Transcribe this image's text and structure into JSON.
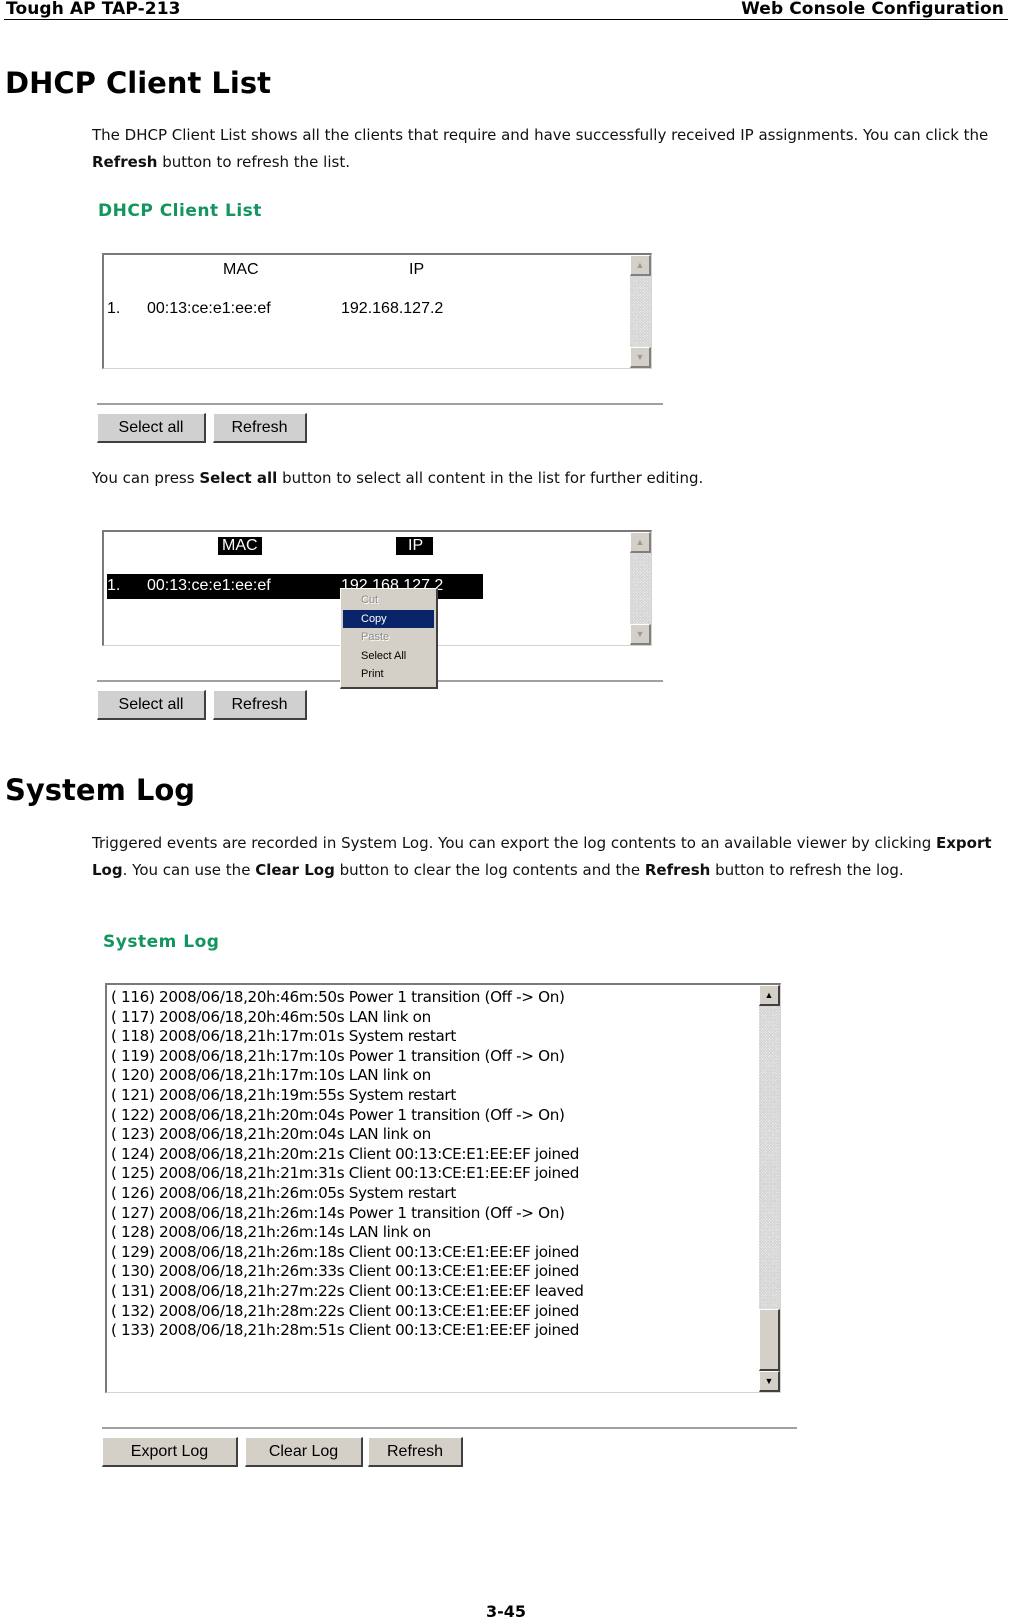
{
  "header": {
    "product": "Tough AP TAP-213",
    "section": "Web Console Configuration"
  },
  "dhcp": {
    "heading": "DHCP Client List",
    "intro": {
      "pre": "The DHCP Client List shows all the clients that require and have successfully received IP assignments. You can click the ",
      "bold": "Refresh",
      "post": " button to refresh the list."
    },
    "panel_title": "DHCP Client List",
    "columns": {
      "mac": "MAC",
      "ip": "IP"
    },
    "clients": [
      {
        "index": "1.",
        "mac": "00:13:ce:e1:ee:ef",
        "ip": "192.168.127.2"
      }
    ],
    "buttons": {
      "select_all": "Select all",
      "refresh": "Refresh"
    },
    "select_all_note": {
      "pre": "You can press ",
      "bold": "Select all",
      "post": " button to select all content in the list for further editing."
    },
    "context_menu": [
      {
        "label": "Cut",
        "state": "disabled"
      },
      {
        "label": "Copy",
        "state": "active"
      },
      {
        "label": "Paste",
        "state": "disabled"
      },
      {
        "label": "Select All",
        "state": "enabled"
      },
      {
        "label": "Print",
        "state": "enabled"
      }
    ]
  },
  "syslog": {
    "heading": "System Log",
    "intro": {
      "p1": "Triggered events are recorded in System Log. You can export the log contents to an available viewer by clicking ",
      "b1": "Export Log",
      "p2": ". You can use the ",
      "b2": "Clear Log",
      "p3": " button to clear the log contents and the ",
      "b3": "Refresh",
      "p4": " button to refresh the log."
    },
    "panel_title": "System Log",
    "entries": [
      "( 116) 2008/06/18,20h:46m:50s Power 1 transition (Off -> On)",
      "( 117) 2008/06/18,20h:46m:50s LAN link on",
      "( 118) 2008/06/18,21h:17m:01s System restart",
      "( 119) 2008/06/18,21h:17m:10s Power 1 transition (Off -> On)",
      "( 120) 2008/06/18,21h:17m:10s LAN link on",
      "( 121) 2008/06/18,21h:19m:55s System restart",
      "( 122) 2008/06/18,21h:20m:04s Power 1 transition (Off -> On)",
      "( 123) 2008/06/18,21h:20m:04s LAN link on",
      "( 124) 2008/06/18,21h:20m:21s Client 00:13:CE:E1:EE:EF joined",
      "( 125) 2008/06/18,21h:21m:31s Client 00:13:CE:E1:EE:EF joined",
      "( 126) 2008/06/18,21h:26m:05s System restart",
      "( 127) 2008/06/18,21h:26m:14s Power 1 transition (Off -> On)",
      "( 128) 2008/06/18,21h:26m:14s LAN link on",
      "( 129) 2008/06/18,21h:26m:18s Client 00:13:CE:E1:EE:EF joined",
      "( 130) 2008/06/18,21h:26m:33s Client 00:13:CE:E1:EE:EF joined",
      "( 131) 2008/06/18,21h:27m:22s Client 00:13:CE:E1:EE:EF leaved",
      "( 132) 2008/06/18,21h:28m:22s Client 00:13:CE:E1:EE:EF joined",
      "( 133) 2008/06/18,21h:28m:51s Client 00:13:CE:E1:EE:EF joined"
    ],
    "scroll_position": "bottom",
    "buttons": {
      "export": "Export Log",
      "clear": "Clear Log",
      "refresh": "Refresh"
    }
  },
  "footer": {
    "page_number": "3-45"
  },
  "icons": {
    "scroll_up": "▲",
    "scroll_down": "▼"
  },
  "colors": {
    "panel_title": "#12955e",
    "menu_highlight": "#0a246a",
    "button_face": "#d4d0c8"
  }
}
